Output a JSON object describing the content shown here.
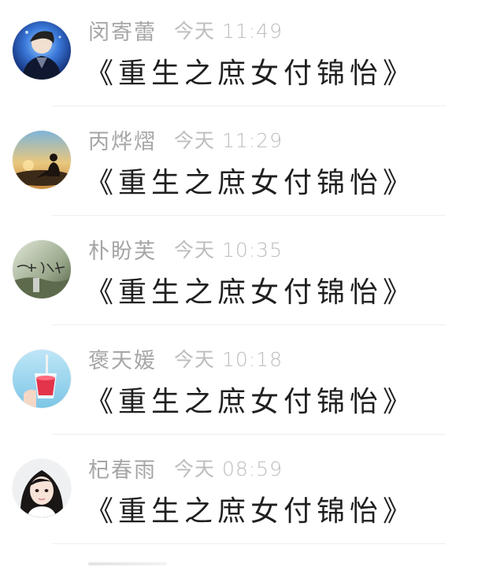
{
  "messages": [
    {
      "sender": "闵寄蕾",
      "time": "今天 11:49",
      "text": "《重生之庶女付锦怡》",
      "avatar_icon": "boy-in-dark-jacket-avatar"
    },
    {
      "sender": "丙烨熠",
      "time": "今天 11:29",
      "text": "《重生之庶女付锦怡》",
      "avatar_icon": "sunset-silhouette-avatar"
    },
    {
      "sender": "朴盼芙",
      "time": "今天 10:35",
      "text": "《重生之庶女付锦怡》",
      "avatar_icon": "calligraphy-scene-avatar"
    },
    {
      "sender": "褒天媛",
      "time": "今天 10:18",
      "text": "《重生之庶女付锦怡》",
      "avatar_icon": "red-drink-avatar"
    },
    {
      "sender": "杞春雨",
      "time": "今天 08:59",
      "text": "《重生之庶女付锦怡》",
      "avatar_icon": "girl-portrait-avatar"
    }
  ],
  "colors": {
    "name": "#a6a6a6",
    "time": "#bdbdbd",
    "message": "#1f1f1f",
    "divider": "#efefef"
  }
}
